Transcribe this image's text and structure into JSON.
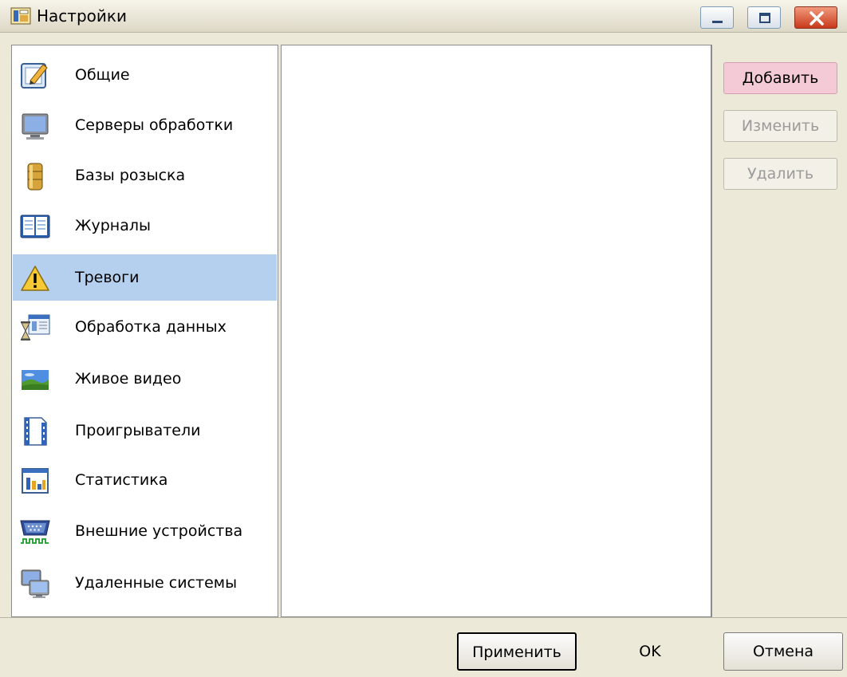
{
  "window": {
    "title": "Настройки"
  },
  "nav": {
    "items": [
      {
        "label": "Общие",
        "icon": "edit-document-icon"
      },
      {
        "label": "Серверы обработки",
        "icon": "monitor-icon"
      },
      {
        "label": "Базы розыска",
        "icon": "database-icon"
      },
      {
        "label": "Журналы",
        "icon": "book-icon"
      },
      {
        "label": "Тревоги",
        "icon": "warning-icon"
      },
      {
        "label": "Обработка данных",
        "icon": "data-processing-icon"
      },
      {
        "label": "Живое видео",
        "icon": "landscape-video-icon"
      },
      {
        "label": "Проигрыватели",
        "icon": "film-strip-icon"
      },
      {
        "label": "Статистика",
        "icon": "bar-chart-icon"
      },
      {
        "label": "Внешние устройства",
        "icon": "serial-port-icon"
      },
      {
        "label": "Удаленные системы",
        "icon": "remote-computers-icon"
      }
    ],
    "selected_index": 4
  },
  "side_buttons": {
    "add": "Добавить",
    "edit": "Изменить",
    "delete": "Удалить"
  },
  "footer": {
    "apply": "Применить",
    "ok": "OK",
    "cancel": "Отмена"
  },
  "colors": {
    "selection": "#b5d0ef",
    "add_button_highlight": "#f3cad6",
    "close_button": "#d2452a"
  }
}
